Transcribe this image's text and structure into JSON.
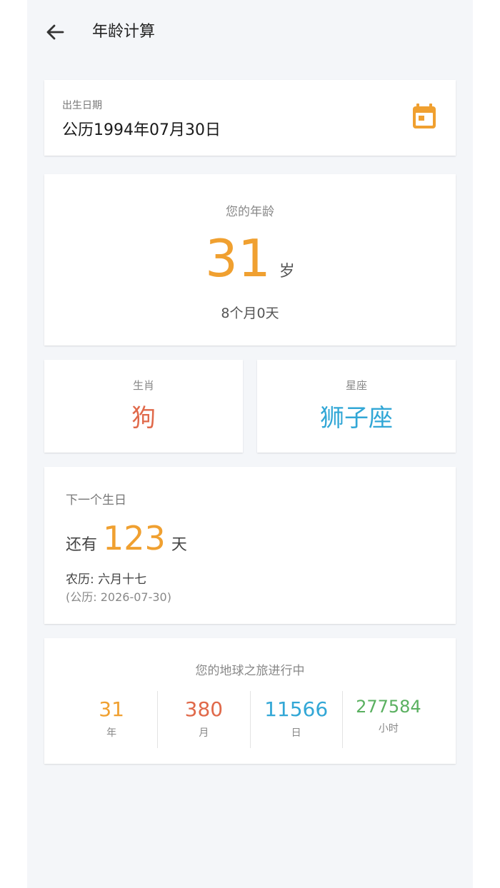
{
  "header": {
    "title": "年龄计算",
    "back_icon": "arrow-left-icon"
  },
  "birth": {
    "label": "出生日期",
    "value": "公历1994年07月30日",
    "icon": "calendar-icon"
  },
  "age": {
    "label": "您的年龄",
    "years": "31",
    "unit": "岁",
    "extra": "8个月0天"
  },
  "zodiac": {
    "label": "生肖",
    "value": "狗"
  },
  "constellation": {
    "label": "星座",
    "value": "狮子座"
  },
  "next_birthday": {
    "label": "下一个生日",
    "prefix": "还有",
    "days": "123",
    "suffix": "天",
    "lunar": "农历: 六月十七",
    "solar": "(公历: 2026-07-30)"
  },
  "journey": {
    "title": "您的地球之旅进行中",
    "stats": [
      {
        "value": "31",
        "unit": "年"
      },
      {
        "value": "380",
        "unit": "月"
      },
      {
        "value": "11566",
        "unit": "日"
      },
      {
        "value": "277584",
        "unit": "小时"
      }
    ]
  },
  "colors": {
    "accent_orange": "#f0a030",
    "zodiac_red": "#e0694a",
    "constellation_blue": "#32a7d6",
    "hours_green": "#5ab060",
    "background": "#f4f6f9"
  }
}
